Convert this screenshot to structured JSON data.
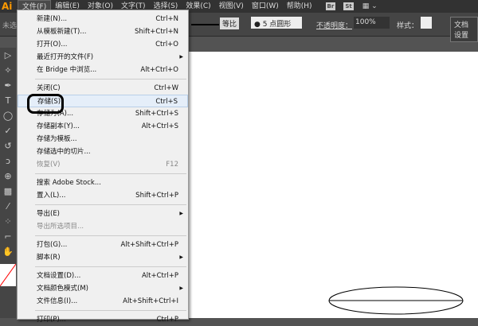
{
  "menubar": {
    "logo": "Ai",
    "items": [
      "文件(F)",
      "编辑(E)",
      "对象(O)",
      "文字(T)",
      "选择(S)",
      "效果(C)",
      "视图(V)",
      "窗口(W)",
      "帮助(H)"
    ],
    "br": "Br",
    "st": "St"
  },
  "control": {
    "left_label": "未选",
    "ratio": "等比",
    "brush": "5 点圆形",
    "opacity_label": "不透明度：",
    "opacity": "100%",
    "style_label": "样式：",
    "doc_setup": "文档设置"
  },
  "menu": [
    {
      "label": "新建(N)...",
      "shortcut": "Ctrl+N"
    },
    {
      "label": "从模板新建(T)...",
      "shortcut": "Shift+Ctrl+N"
    },
    {
      "label": "打开(O)...",
      "shortcut": "Ctrl+O"
    },
    {
      "label": "最近打开的文件(F)",
      "shortcut": "",
      "submenu": true
    },
    {
      "label": "在 Bridge 中浏览...",
      "shortcut": "Alt+Ctrl+O"
    },
    {
      "sep": true
    },
    {
      "label": "关闭(C)",
      "shortcut": "Ctrl+W"
    },
    {
      "label": "存储(S)",
      "shortcut": "Ctrl+S",
      "highlight": true
    },
    {
      "label": "存储为(A)...",
      "shortcut": "Shift+Ctrl+S"
    },
    {
      "label": "存储副本(Y)...",
      "shortcut": "Alt+Ctrl+S"
    },
    {
      "label": "存储为模板...",
      "shortcut": ""
    },
    {
      "label": "存储选中的切片...",
      "shortcut": ""
    },
    {
      "label": "恢复(V)",
      "shortcut": "F12",
      "disabled": true
    },
    {
      "sep": true
    },
    {
      "label": "搜索 Adobe Stock...",
      "shortcut": ""
    },
    {
      "label": "置入(L)...",
      "shortcut": "Shift+Ctrl+P"
    },
    {
      "sep": true
    },
    {
      "label": "导出(E)",
      "shortcut": "",
      "submenu": true
    },
    {
      "label": "导出所选项目...",
      "shortcut": "",
      "disabled": true
    },
    {
      "sep": true
    },
    {
      "label": "打包(G)...",
      "shortcut": "Alt+Shift+Ctrl+P"
    },
    {
      "label": "脚本(R)",
      "shortcut": "",
      "submenu": true
    },
    {
      "sep": true
    },
    {
      "label": "文档设置(D)...",
      "shortcut": "Alt+Ctrl+P"
    },
    {
      "label": "文档颜色模式(M)",
      "shortcut": "",
      "submenu": true
    },
    {
      "label": "文件信息(I)...",
      "shortcut": "Alt+Shift+Ctrl+I"
    },
    {
      "sep": true
    },
    {
      "label": "打印(P)...",
      "shortcut": "Ctrl+P"
    }
  ]
}
